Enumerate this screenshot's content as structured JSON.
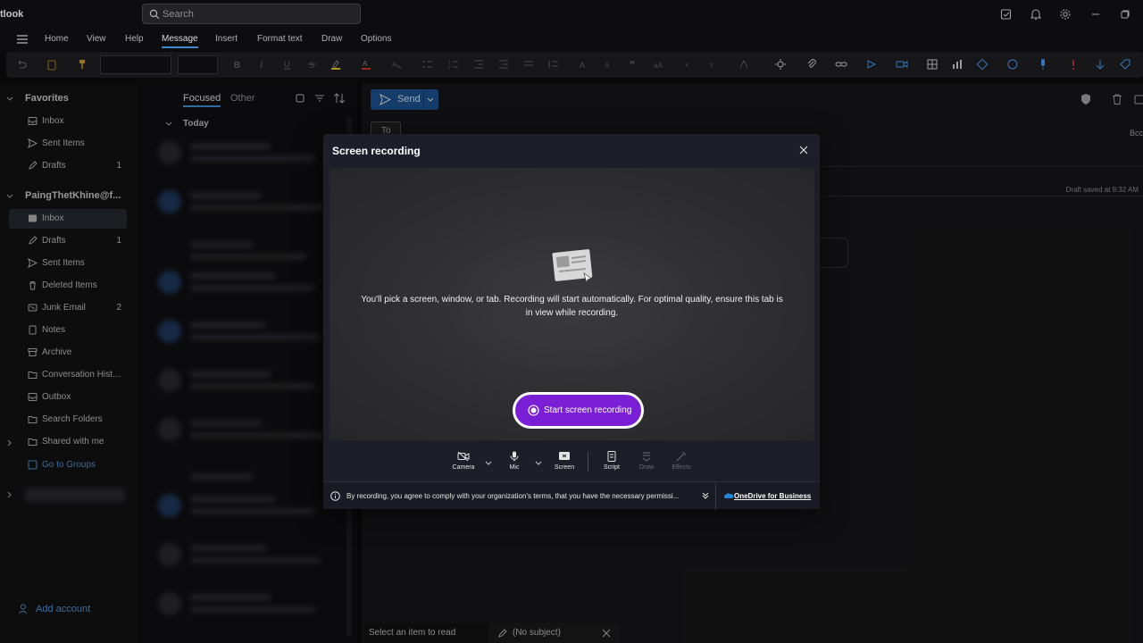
{
  "titlebar": {
    "app_name": "tlook",
    "search_placeholder": "Search"
  },
  "menu": [
    "Home",
    "View",
    "Help",
    "Message",
    "Insert",
    "Format text",
    "Draw",
    "Options"
  ],
  "menu_active": "Message",
  "nav": {
    "favorites_label": "Favorites",
    "favorites": [
      {
        "label": "Inbox",
        "count": ""
      },
      {
        "label": "Sent Items",
        "count": ""
      },
      {
        "label": "Drafts",
        "count": "1"
      }
    ],
    "account_label": "PaingThetKhine@f...",
    "folders": [
      {
        "label": "Inbox",
        "count": ""
      },
      {
        "label": "Drafts",
        "count": "1"
      },
      {
        "label": "Sent Items",
        "count": ""
      },
      {
        "label": "Deleted Items",
        "count": ""
      },
      {
        "label": "Junk Email",
        "count": "2"
      },
      {
        "label": "Notes",
        "count": ""
      },
      {
        "label": "Archive",
        "count": ""
      },
      {
        "label": "Conversation Histo...",
        "count": ""
      },
      {
        "label": "Outbox",
        "count": ""
      },
      {
        "label": "Search Folders",
        "count": ""
      },
      {
        "label": "Shared with me",
        "count": ""
      },
      {
        "label": "Go to Groups",
        "count": ""
      }
    ],
    "add_account": "Add account"
  },
  "msglist": {
    "tab_focused": "Focused",
    "tab_other": "Other",
    "group_today": "Today"
  },
  "compose": {
    "send_label": "Send",
    "to_label": "To",
    "bcc_label": "Bcc",
    "draft_saved": "Draft saved at 9:32 AM"
  },
  "bottom_tabs": {
    "read": "Select an item to read",
    "draft": "(No subject)"
  },
  "dialog": {
    "title": "Screen recording",
    "description": "You'll pick a screen, window, or tab. Recording will start automatically. For optimal quality, ensure this tab is in view while recording.",
    "start_button": "Start screen recording",
    "tools": {
      "camera": "Camera",
      "mic": "Mic",
      "screen": "Screen",
      "script": "Script",
      "draw": "Draw",
      "effects": "Effects"
    },
    "consent": "By recording, you agree to comply with your organization's terms, that you have the necessary permissi...",
    "onedrive": "OneDrive for Business"
  },
  "colors": {
    "accent": "#4aa3f0",
    "send": "#1f5fa5",
    "record": "#7a1fd6"
  }
}
